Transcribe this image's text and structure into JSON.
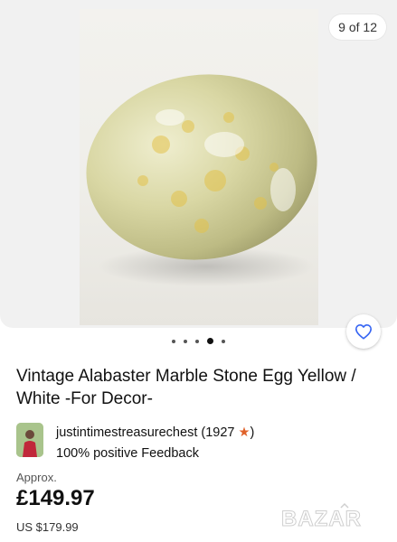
{
  "gallery": {
    "counter": "9 of 12",
    "dots_count": 5,
    "active_dot": 3,
    "favorite_icon": "heart-outline-icon"
  },
  "listing": {
    "title": "Vintage Alabaster Marble Stone Egg Yellow / White -For Decor-",
    "seller": {
      "name": "justintimestreasurechest",
      "score_open": "(1927",
      "star_icon": "star-icon",
      "score_close": ")",
      "feedback": "100% positive Feedback"
    },
    "price": {
      "approx_label": "Approx.",
      "value": "£149.97",
      "usd": "US $179.99"
    }
  },
  "watermark": {
    "text": "BAZAR"
  },
  "colors": {
    "accent_blue": "#3665f3",
    "star": "#e0622a",
    "photo_bg": "#f1f1f1"
  }
}
